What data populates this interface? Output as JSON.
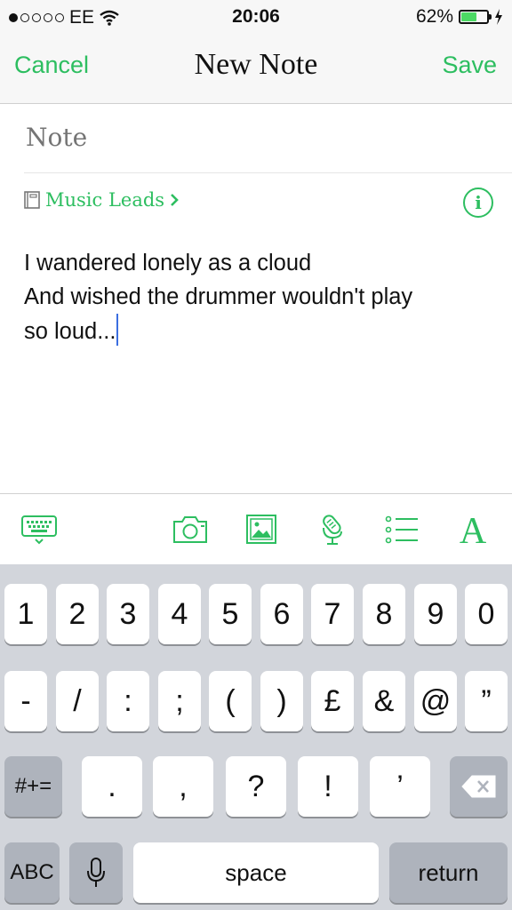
{
  "status_bar": {
    "carrier": "EE",
    "time": "20:06",
    "battery_percent": "62%",
    "battery_level": 0.62,
    "signal_bars": 1,
    "signal_total": 5
  },
  "nav": {
    "cancel_label": "Cancel",
    "title": "New Note",
    "save_label": "Save"
  },
  "note": {
    "title_placeholder": "Note",
    "notebook": "Music Leads",
    "notebook_chevron": "›",
    "info_glyph": "i",
    "body_lines": [
      "I wandered lonely as a cloud",
      "And wished the drummer wouldn't play",
      "so loud..."
    ]
  },
  "toolbar": {
    "icons": [
      "keyboard-hide-icon",
      "camera-icon",
      "image-icon",
      "audio-icon",
      "list-icon",
      "text-format-icon"
    ],
    "text_format_glyph": "A"
  },
  "keyboard": {
    "row1": [
      "1",
      "2",
      "3",
      "4",
      "5",
      "6",
      "7",
      "8",
      "9",
      "0"
    ],
    "row2": [
      "-",
      "/",
      ":",
      ";",
      "(",
      ")",
      "£",
      "&",
      "@",
      "”"
    ],
    "row3": [
      ".",
      ",",
      "?",
      "!",
      "’"
    ],
    "symbols_label": "#+=",
    "abc_label": "ABC",
    "space_label": "space",
    "return_label": "return"
  },
  "colors": {
    "accent": "#2dbe60",
    "caret": "#3b6ee0",
    "keyboard_bg": "#d2d5db",
    "battery_fill": "#4cd964"
  }
}
